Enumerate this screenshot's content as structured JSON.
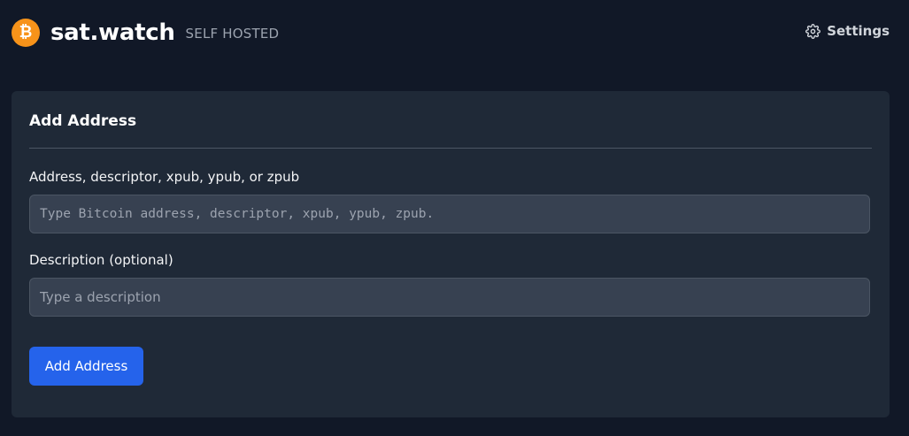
{
  "header": {
    "logo_symbol": "₿",
    "logo_icon": "bitcoin-icon",
    "app_name": "sat.watch",
    "tagline": "SELF HOSTED",
    "settings_label": "Settings",
    "settings_icon": "gear-icon"
  },
  "card": {
    "title": "Add Address",
    "address_field": {
      "label": "Address, descriptor, xpub, ypub, or zpub",
      "placeholder": "Type Bitcoin address, descriptor, xpub, ypub, zpub.",
      "value": ""
    },
    "description_field": {
      "label": "Description (optional)",
      "placeholder": "Type a description",
      "value": ""
    },
    "submit_label": "Add Address"
  },
  "colors": {
    "background": "#111827",
    "card": "#1f2937",
    "input": "#374151",
    "accent": "#2563eb",
    "bitcoin": "#f7931a"
  }
}
